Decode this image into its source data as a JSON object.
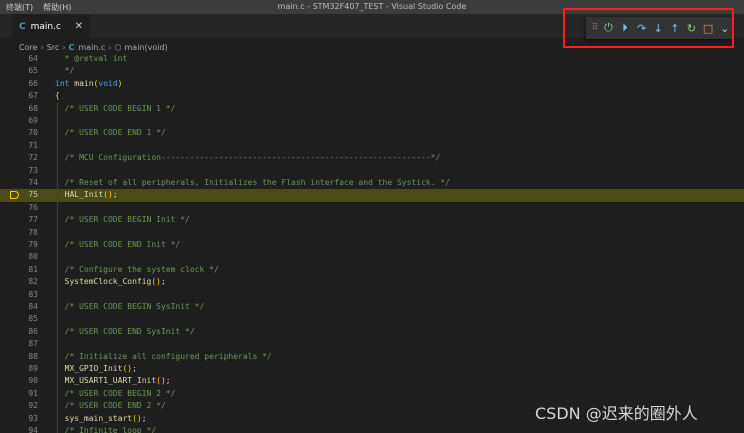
{
  "menu": [
    "终端(T)",
    "帮助(H)"
  ],
  "window_title": "main.c - STM32F407_TEST - Visual Studio Code",
  "tab": {
    "icon_letter": "C",
    "label": "main.c",
    "close": "✕"
  },
  "breadcrumb": {
    "parts": [
      "Core",
      "Src"
    ],
    "file_icon": "C",
    "file": "main.c",
    "symbol": "main(void)"
  },
  "debug_toolbar": {
    "buttons": [
      {
        "name": "drag-handle",
        "glyph": "⠿",
        "color": "#888888"
      },
      {
        "name": "restart-power-icon",
        "glyph": "⏻",
        "color": "#89d185"
      },
      {
        "name": "continue-icon",
        "glyph": "⏵",
        "color": "#75beff"
      },
      {
        "name": "step-over-icon",
        "glyph": "↷",
        "color": "#75beff"
      },
      {
        "name": "step-into-icon",
        "glyph": "↓",
        "color": "#75beff"
      },
      {
        "name": "step-out-icon",
        "glyph": "↑",
        "color": "#75beff"
      },
      {
        "name": "restart-icon",
        "glyph": "↻",
        "color": "#89d185"
      },
      {
        "name": "stop-icon",
        "glyph": "□",
        "color": "#f48771"
      },
      {
        "name": "chevron-down-icon",
        "glyph": "⌄",
        "color": "#cccccc"
      }
    ]
  },
  "colors": {
    "current_line": "#4b4b18",
    "highlight_box": "#ff1e1e",
    "comment": "#6a9955",
    "keyword": "#569cd6",
    "function": "#dcdcaa"
  },
  "lines": [
    {
      "n": "64",
      "type": "cm",
      "text": "  * @retval int"
    },
    {
      "n": "65",
      "type": "cm",
      "text": "  */"
    },
    {
      "n": "66",
      "type": "sig",
      "text": "int main(void)"
    },
    {
      "n": "67",
      "type": "br",
      "text": "{"
    },
    {
      "n": "68",
      "type": "cm",
      "text": "  /* USER CODE BEGIN 1 */"
    },
    {
      "n": "69",
      "type": "empty",
      "text": ""
    },
    {
      "n": "70",
      "type": "cm",
      "text": "  /* USER CODE END 1 */"
    },
    {
      "n": "71",
      "type": "empty",
      "text": ""
    },
    {
      "n": "72",
      "type": "cm",
      "text": "  /* MCU Configuration--------------------------------------------------------*/"
    },
    {
      "n": "73",
      "type": "empty",
      "text": ""
    },
    {
      "n": "74",
      "type": "cm",
      "text": "  /* Reset of all peripherals, Initializes the Flash interface and the Systick. */"
    },
    {
      "n": "75",
      "type": "call",
      "text": "  HAL_Init();",
      "current": true
    },
    {
      "n": "76",
      "type": "empty",
      "text": ""
    },
    {
      "n": "77",
      "type": "cm",
      "text": "  /* USER CODE BEGIN Init */"
    },
    {
      "n": "78",
      "type": "empty",
      "text": ""
    },
    {
      "n": "79",
      "type": "cm",
      "text": "  /* USER CODE END Init */"
    },
    {
      "n": "80",
      "type": "empty",
      "text": ""
    },
    {
      "n": "81",
      "type": "cm",
      "text": "  /* Configure the system clock */"
    },
    {
      "n": "82",
      "type": "call",
      "text": "  SystemClock_Config();"
    },
    {
      "n": "83",
      "type": "empty",
      "text": ""
    },
    {
      "n": "84",
      "type": "cm",
      "text": "  /* USER CODE BEGIN SysInit */"
    },
    {
      "n": "85",
      "type": "empty",
      "text": ""
    },
    {
      "n": "86",
      "type": "cm",
      "text": "  /* USER CODE END SysInit */"
    },
    {
      "n": "87",
      "type": "empty",
      "text": ""
    },
    {
      "n": "88",
      "type": "cm",
      "text": "  /* Initialize all configured peripherals */"
    },
    {
      "n": "89",
      "type": "call",
      "text": "  MX_GPIO_Init();"
    },
    {
      "n": "90",
      "type": "call",
      "text": "  MX_USART1_UART_Init();"
    },
    {
      "n": "91",
      "type": "cm",
      "text": "  /* USER CODE BEGIN 2 */"
    },
    {
      "n": "92",
      "type": "cm",
      "text": "  /* USER CODE END 2 */"
    },
    {
      "n": "93",
      "type": "call",
      "text": "  sys_main_start();"
    },
    {
      "n": "94",
      "type": "cm",
      "text": "  /* Infinite loop */"
    }
  ],
  "watermark": "CSDN @迟来的圈外人"
}
